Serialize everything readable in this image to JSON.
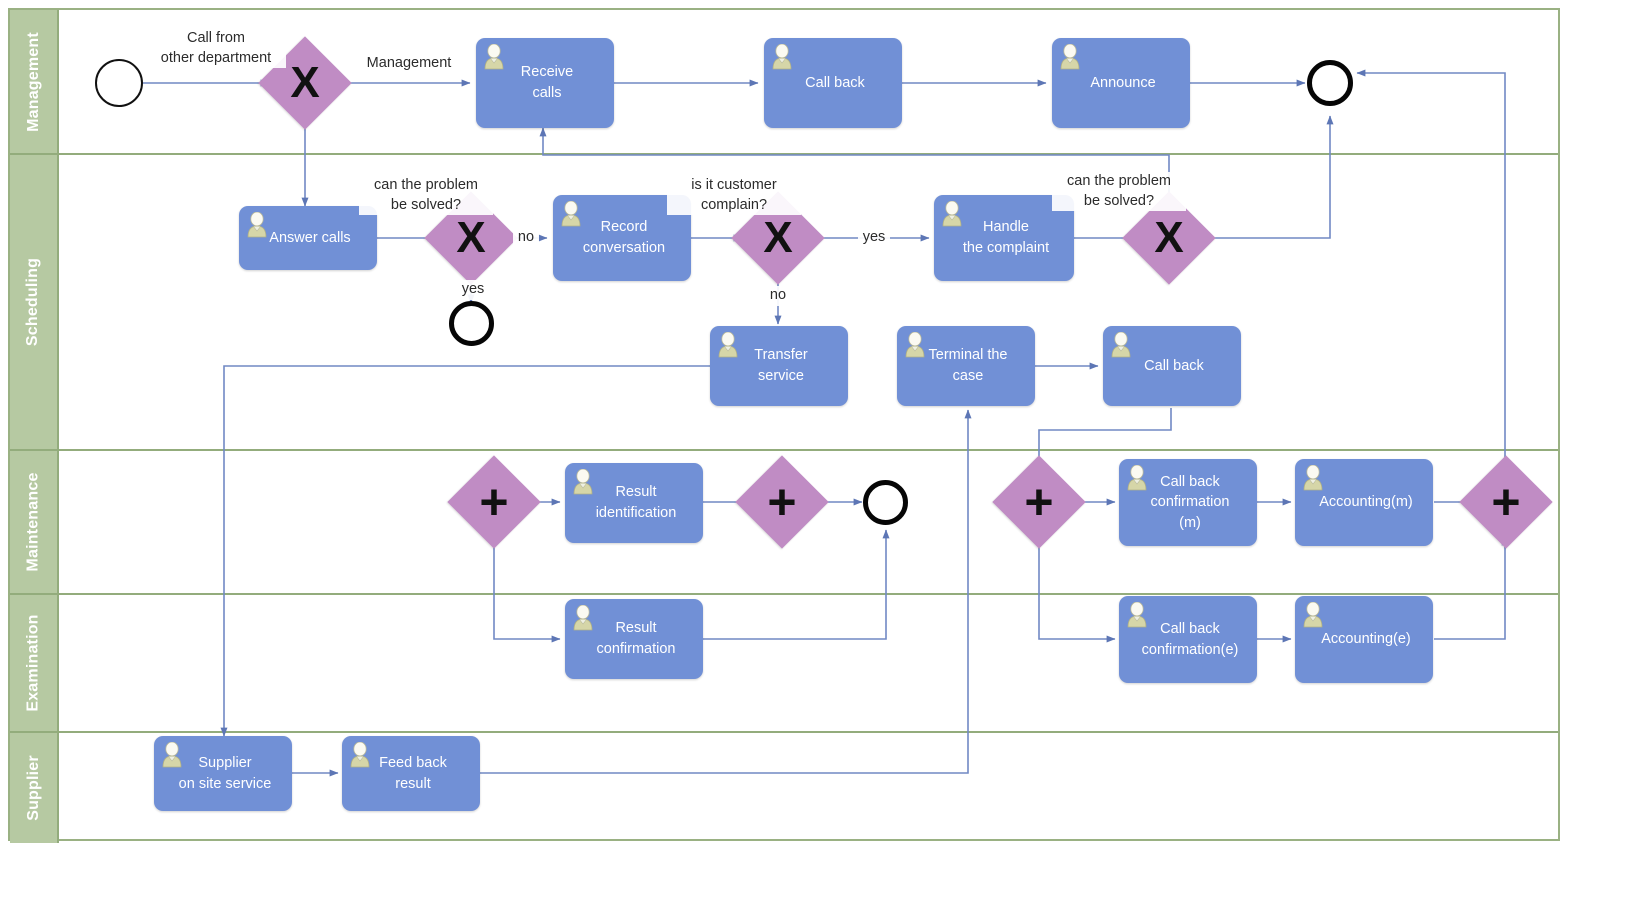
{
  "diagram": {
    "type": "BPMN swimlane process diagram",
    "pool_border_color": "#9ab183",
    "lane_header_color": "#b6c9a2",
    "task_color": "#7190d6",
    "gateway_color": "#c08cc4",
    "edge_color": "#7189c4"
  },
  "lanes": [
    {
      "id": "management",
      "label": "Management"
    },
    {
      "id": "scheduling",
      "label": "Scheduling"
    },
    {
      "id": "maintenance",
      "label": "Maintenance"
    },
    {
      "id": "examination",
      "label": "Examination"
    },
    {
      "id": "supplier",
      "label": "Supplier"
    }
  ],
  "events": [
    {
      "id": "start",
      "kind": "start",
      "lane": "management"
    },
    {
      "id": "end_mgmt",
      "kind": "end",
      "lane": "management"
    },
    {
      "id": "end_sched",
      "kind": "end",
      "lane": "scheduling"
    },
    {
      "id": "end_maint",
      "kind": "end",
      "lane": "maintenance"
    }
  ],
  "tasks": [
    {
      "id": "receive_calls",
      "label": "Receive\ncalls",
      "lane": "management"
    },
    {
      "id": "call_back_mgmt",
      "label": "Call back",
      "lane": "management"
    },
    {
      "id": "announce",
      "label": "Announce",
      "lane": "management"
    },
    {
      "id": "answer_calls",
      "label": "Answer calls",
      "lane": "scheduling"
    },
    {
      "id": "record_conv",
      "label": "Record\nconversation",
      "lane": "scheduling"
    },
    {
      "id": "handle_complaint",
      "label": "Handle\nthe complaint",
      "lane": "scheduling"
    },
    {
      "id": "transfer_service",
      "label": "Transfer\nservice",
      "lane": "scheduling"
    },
    {
      "id": "terminal_case",
      "label": "Terminal the\ncase",
      "lane": "scheduling"
    },
    {
      "id": "call_back_sched",
      "label": "Call back",
      "lane": "scheduling"
    },
    {
      "id": "result_ident",
      "label": "Result\nidentification",
      "lane": "maintenance"
    },
    {
      "id": "cbc_m",
      "label": "Call back\nconfirmation\n(m)",
      "lane": "maintenance"
    },
    {
      "id": "accounting_m",
      "label": "Accounting(m)",
      "lane": "maintenance"
    },
    {
      "id": "result_conf",
      "label": "Result\nconfirmation",
      "lane": "examination"
    },
    {
      "id": "cbc_e",
      "label": "Call back\nconfirmation(e)",
      "lane": "examination"
    },
    {
      "id": "accounting_e",
      "label": "Accounting(e)",
      "lane": "examination"
    },
    {
      "id": "supplier_onsite",
      "label": "Supplier\non site service",
      "lane": "supplier"
    },
    {
      "id": "feed_back_result",
      "label": "Feed back\nresult",
      "lane": "supplier"
    }
  ],
  "gateways": [
    {
      "id": "gw_route",
      "kind": "exclusive",
      "symbol": "X",
      "lane": "management"
    },
    {
      "id": "gw_solved1",
      "kind": "exclusive",
      "symbol": "X",
      "lane": "scheduling"
    },
    {
      "id": "gw_complain",
      "kind": "exclusive",
      "symbol": "X",
      "lane": "scheduling"
    },
    {
      "id": "gw_solved2",
      "kind": "exclusive",
      "symbol": "X",
      "lane": "scheduling"
    },
    {
      "id": "gw_split_l",
      "kind": "parallel",
      "symbol": "+",
      "lane": "maintenance"
    },
    {
      "id": "gw_join_l",
      "kind": "parallel",
      "symbol": "+",
      "lane": "maintenance"
    },
    {
      "id": "gw_split_r",
      "kind": "parallel",
      "symbol": "+",
      "lane": "maintenance"
    },
    {
      "id": "gw_join_r",
      "kind": "parallel",
      "symbol": "+",
      "lane": "maintenance"
    }
  ],
  "edge_labels": [
    {
      "id": "lbl_call_from",
      "text": "Call from\nother department"
    },
    {
      "id": "lbl_management",
      "text": "Management"
    },
    {
      "id": "lbl_solved1",
      "text": "can the problem\nbe solved?"
    },
    {
      "id": "lbl_no1",
      "text": "no"
    },
    {
      "id": "lbl_yes1",
      "text": "yes"
    },
    {
      "id": "lbl_complain",
      "text": "is it customer\ncomplain?"
    },
    {
      "id": "lbl_yes2",
      "text": "yes"
    },
    {
      "id": "lbl_no2",
      "text": "no"
    },
    {
      "id": "lbl_solved2",
      "text": "can the problem\nbe solved?"
    }
  ]
}
